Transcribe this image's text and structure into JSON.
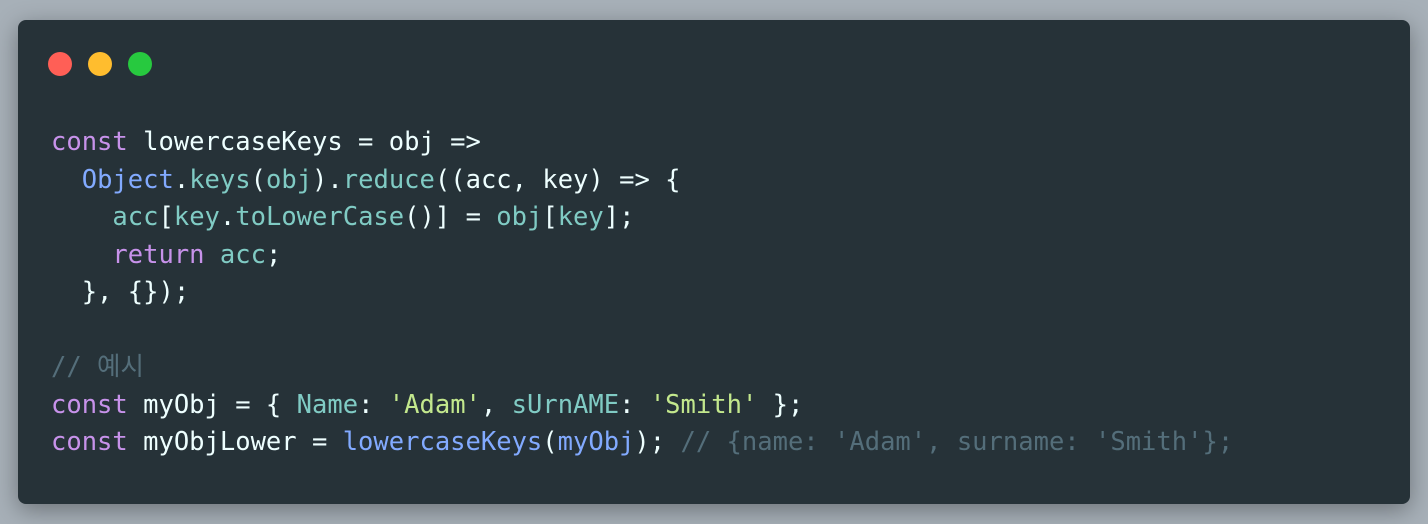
{
  "window": {
    "background": "#263238",
    "controls": [
      {
        "name": "close",
        "color": "#ff5f56"
      },
      {
        "name": "minimize",
        "color": "#ffbd2e"
      },
      {
        "name": "zoom",
        "color": "#27c93f"
      }
    ]
  },
  "theme": {
    "keyword": "#c792ea",
    "plain": "#eeffff",
    "func": "#82aaff",
    "ident": "#80cbc4",
    "string": "#c3e88d",
    "comment": "#546e7a"
  },
  "code_lines": [
    [
      {
        "t": "const",
        "k": "keyword"
      },
      {
        "t": " lowercaseKeys = obj =>",
        "k": "plain"
      }
    ],
    [
      {
        "t": "  ",
        "k": "plain"
      },
      {
        "t": "Object",
        "k": "func"
      },
      {
        "t": ".",
        "k": "plain"
      },
      {
        "t": "keys",
        "k": "ident"
      },
      {
        "t": "(",
        "k": "plain"
      },
      {
        "t": "obj",
        "k": "ident"
      },
      {
        "t": ").",
        "k": "plain"
      },
      {
        "t": "reduce",
        "k": "ident"
      },
      {
        "t": "((acc, key) => {",
        "k": "plain"
      }
    ],
    [
      {
        "t": "    ",
        "k": "plain"
      },
      {
        "t": "acc",
        "k": "ident"
      },
      {
        "t": "[",
        "k": "plain"
      },
      {
        "t": "key",
        "k": "ident"
      },
      {
        "t": ".",
        "k": "plain"
      },
      {
        "t": "toLowerCase",
        "k": "ident"
      },
      {
        "t": "()] = ",
        "k": "plain"
      },
      {
        "t": "obj",
        "k": "ident"
      },
      {
        "t": "[",
        "k": "plain"
      },
      {
        "t": "key",
        "k": "ident"
      },
      {
        "t": "];",
        "k": "plain"
      }
    ],
    [
      {
        "t": "    ",
        "k": "plain"
      },
      {
        "t": "return",
        "k": "keyword"
      },
      {
        "t": " ",
        "k": "plain"
      },
      {
        "t": "acc",
        "k": "ident"
      },
      {
        "t": ";",
        "k": "plain"
      }
    ],
    [
      {
        "t": "  }, {});",
        "k": "plain"
      }
    ],
    [],
    [
      {
        "t": "// 예시",
        "k": "comment"
      }
    ],
    [
      {
        "t": "const",
        "k": "keyword"
      },
      {
        "t": " myObj = { ",
        "k": "plain"
      },
      {
        "t": "Name",
        "k": "ident"
      },
      {
        "t": ": ",
        "k": "plain"
      },
      {
        "t": "'Adam'",
        "k": "string"
      },
      {
        "t": ", ",
        "k": "plain"
      },
      {
        "t": "sUrnAME",
        "k": "ident"
      },
      {
        "t": ": ",
        "k": "plain"
      },
      {
        "t": "'Smith'",
        "k": "string"
      },
      {
        "t": " };",
        "k": "plain"
      }
    ],
    [
      {
        "t": "const",
        "k": "keyword"
      },
      {
        "t": " myObjLower = ",
        "k": "plain"
      },
      {
        "t": "lowercaseKeys",
        "k": "func"
      },
      {
        "t": "(",
        "k": "plain"
      },
      {
        "t": "myObj",
        "k": "func"
      },
      {
        "t": "); ",
        "k": "plain"
      },
      {
        "t": "// {name: 'Adam', surname: 'Smith'};",
        "k": "comment"
      }
    ]
  ]
}
